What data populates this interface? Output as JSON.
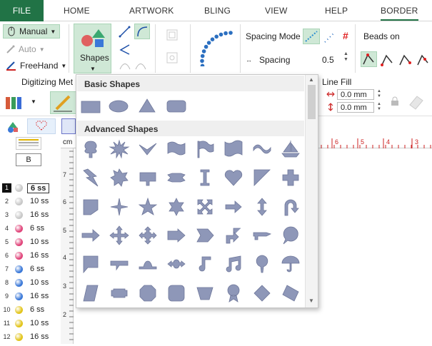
{
  "menu": {
    "file": "FILE",
    "tabs": [
      "HOME",
      "ARTWORK",
      "BLING",
      "VIEW",
      "HELP",
      "BORDER"
    ]
  },
  "ribbon": {
    "manual": "Manual",
    "auto": "Auto",
    "freehand": "FreeHand",
    "shapes": "Shapes",
    "spacing_mode": "Spacing Mode",
    "spacing": "Spacing",
    "spacing_value": "0.5",
    "beads_on": "Beads on",
    "group_label": "Digitizing Met",
    "line_fill": "Line Fill",
    "width_value": "0.0 mm",
    "height_value": "0.0 mm"
  },
  "dropdown": {
    "basic_title": "Basic Shapes",
    "advanced_title": "Advanced Shapes",
    "basic_shapes": [
      "rectangle",
      "ellipse",
      "triangle",
      "rounded-rectangle"
    ],
    "advanced_shapes": [
      "tree",
      "starburst",
      "check",
      "wave-banner",
      "flag",
      "ribbon-banner",
      "wave",
      "ship",
      "lightning",
      "seal-8",
      "sign",
      "bow-banner",
      "i-beam",
      "heart",
      "corner",
      "cross",
      "shield",
      "star-4",
      "star-5",
      "star-6",
      "cross-arrows",
      "arrow-right",
      "arrow-updown",
      "u-turn-arrow",
      "arrow-right-2",
      "four-arrows",
      "four-arrows-2",
      "arrow-callout",
      "chevron-arrow",
      "bent-arrow",
      "left-right-callout",
      "round-callout",
      "rect-callout",
      "line-callout",
      "hat",
      "ellipse-arrows",
      "music-note",
      "music-notes",
      "pin",
      "umbrella",
      "parallelogram",
      "rounded-tab",
      "octagon",
      "rounded-square",
      "trapezoid",
      "award",
      "diamond",
      "tilted-diamond"
    ]
  },
  "leftpanel": {
    "ss_box": "B",
    "unit": "cm",
    "rows": [
      {
        "n": "1",
        "label": "6 ss",
        "color": "#c8c8c8"
      },
      {
        "n": "2",
        "label": "10 ss",
        "color": "#c8c8c8"
      },
      {
        "n": "3",
        "label": "16 ss",
        "color": "#c8c8c8"
      },
      {
        "n": "4",
        "label": "6 ss",
        "color": "#e0447a"
      },
      {
        "n": "5",
        "label": "10 ss",
        "color": "#e0447a"
      },
      {
        "n": "6",
        "label": "16 ss",
        "color": "#e0447a"
      },
      {
        "n": "7",
        "label": "6 ss",
        "color": "#3a78d8"
      },
      {
        "n": "8",
        "label": "10 ss",
        "color": "#3a78d8"
      },
      {
        "n": "9",
        "label": "16 ss",
        "color": "#3a78d8"
      },
      {
        "n": "10",
        "label": "6 ss",
        "color": "#e2c41a"
      },
      {
        "n": "11",
        "label": "10 ss",
        "color": "#e2c41a"
      },
      {
        "n": "12",
        "label": "16 ss",
        "color": "#e2c41a"
      }
    ]
  },
  "ruler": {
    "h_ticks": [
      "6",
      "5",
      "4",
      "3"
    ],
    "v_ticks": [
      "7",
      "6",
      "5",
      "4",
      "3",
      "2"
    ]
  },
  "colors": {
    "accent": "#217346",
    "shape_fill": "#8e97b8",
    "ruler_red": "#cc2222"
  }
}
